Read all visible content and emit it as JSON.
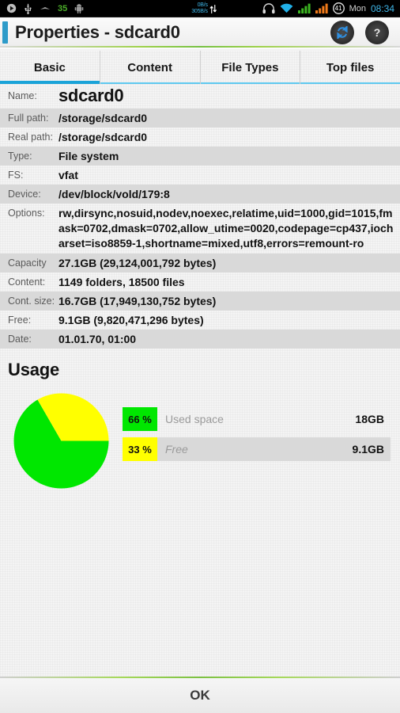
{
  "statusbar": {
    "left_icons": [
      "play-icon",
      "usb-icon",
      "vpn-icon",
      "android-debug-icon"
    ],
    "battery_percent_left": "35",
    "net_up": "0B/s",
    "net_down": "305B/s",
    "right_icons": [
      "headset-icon",
      "wifi-icon",
      "signal-sim1-icon",
      "signal-sim2-icon"
    ],
    "battery_level": "41",
    "day": "Mon",
    "clock": "08:34"
  },
  "titlebar": {
    "title": "Properties - sdcard0",
    "refresh_label": "↻",
    "help_label": "?"
  },
  "tabs": [
    {
      "label": "Basic",
      "active": true
    },
    {
      "label": "Content",
      "active": false
    },
    {
      "label": "File Types",
      "active": false
    },
    {
      "label": "Top files",
      "active": false
    }
  ],
  "properties": [
    {
      "key": "Name:",
      "value": "sdcard0"
    },
    {
      "key": "Full path:",
      "value": "/storage/sdcard0"
    },
    {
      "key": "Real path:",
      "value": "/storage/sdcard0"
    },
    {
      "key": "Type:",
      "value": "File system"
    },
    {
      "key": "FS:",
      "value": "vfat"
    },
    {
      "key": "Device:",
      "value": "/dev/block/vold/179:8"
    },
    {
      "key": "Options:",
      "value": "rw,dirsync,nosuid,nodev,noexec,relatime,uid=1000,gid=1015,fmask=0702,dmask=0702,allow_utime=0020,codepage=cp437,iocharset=iso8859-1,shortname=mixed,utf8,errors=remount-ro"
    },
    {
      "key": "Capacity",
      "value": "27.1GB (29,124,001,792 bytes)"
    },
    {
      "key": "Content:",
      "value": "1149 folders, 18500 files"
    },
    {
      "key": "Cont. size:",
      "value": "16.7GB (17,949,130,752 bytes)"
    },
    {
      "key": "Free:",
      "value": "9.1GB (9,820,471,296 bytes)"
    },
    {
      "key": "Date:",
      "value": "01.01.70, 01:00"
    }
  ],
  "usage": {
    "title": "Usage",
    "legend": [
      {
        "percent": "66 %",
        "name": "Used space",
        "value": "18GB",
        "color": "#00e700"
      },
      {
        "percent": "33 %",
        "name": "Free",
        "value": "9.1GB",
        "color": "#ffff00"
      }
    ]
  },
  "chart_data": {
    "type": "pie",
    "title": "Usage",
    "labels": [
      "Used space",
      "Free"
    ],
    "values": [
      66,
      33
    ],
    "value_labels": [
      "18GB",
      "9.1GB"
    ],
    "colors": [
      "#00e700",
      "#ffff00"
    ],
    "legend": "right"
  },
  "footer": {
    "ok_label": "OK"
  }
}
